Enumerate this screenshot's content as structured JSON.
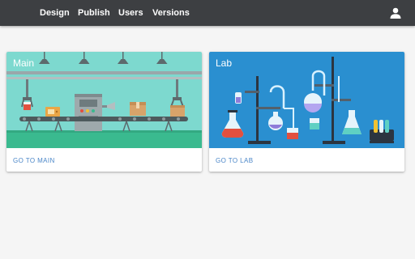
{
  "topbar": {
    "nav": [
      {
        "label": "Design"
      },
      {
        "label": "Publish"
      },
      {
        "label": "Users"
      },
      {
        "label": "Versions"
      }
    ],
    "user_icon": "person-icon",
    "colors": {
      "background": "#3d3f42",
      "text": "#ffffff"
    }
  },
  "cards": [
    {
      "title": "Main",
      "action": "GO TO MAIN",
      "image": "factory-conveyor-illustration",
      "image_bg": "#7dd9cf"
    },
    {
      "title": "Lab",
      "action": "GO TO LAB",
      "image": "chemistry-lab-illustration",
      "image_bg": "#2a8fd0"
    }
  ],
  "colors": {
    "page_bg": "#f5f5f5",
    "action_link": "#4a86c8"
  }
}
